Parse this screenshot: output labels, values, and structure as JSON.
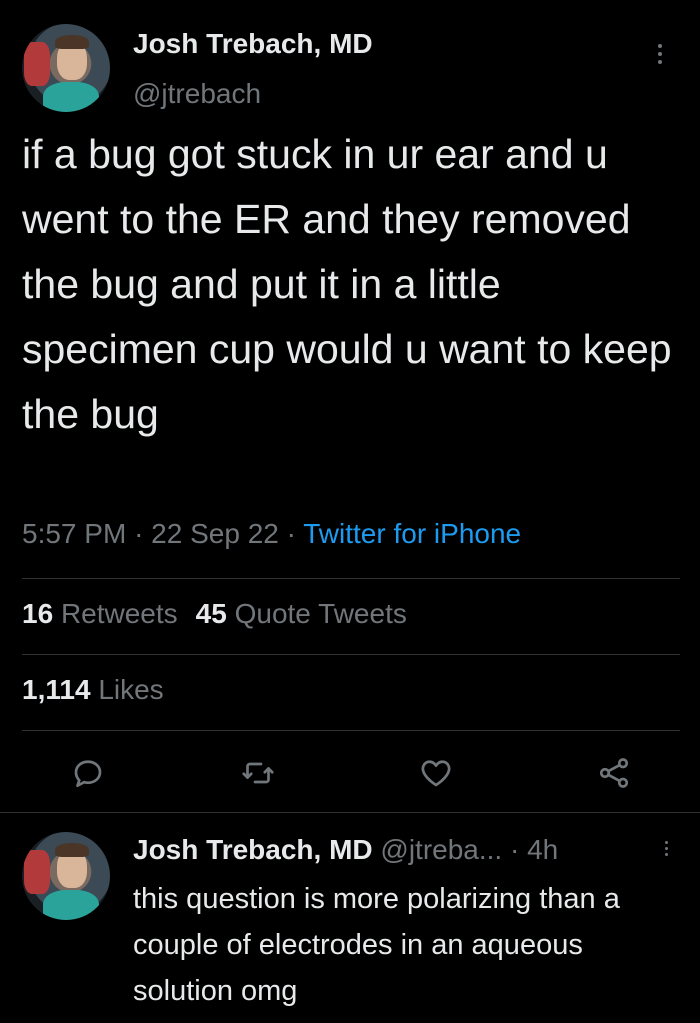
{
  "tweet": {
    "author_name": "Josh Trebach, MD",
    "author_handle": "@jtrebach",
    "text": "if a bug got stuck in ur ear and u went to the ER and they removed the bug and put it in a little specimen cup would u want to keep the bug",
    "time": "5:57 PM",
    "date": "22 Sep 22",
    "source": "Twitter for iPhone",
    "separator": "·",
    "retweets_count": "16",
    "retweets_label": "Retweets",
    "quotes_count": "45",
    "quotes_label": "Quote Tweets",
    "likes_count": "1,114",
    "likes_label": "Likes"
  },
  "actions": {
    "reply_icon": "reply-icon",
    "retweet_icon": "retweet-icon",
    "like_icon": "heart-icon",
    "share_icon": "share-icon"
  },
  "reply": {
    "author_name": "Josh Trebach, MD",
    "author_handle": "@jtreba...",
    "time_ago": "4h",
    "separator": "·",
    "text": "this question is more polarizing than a couple of electrodes in an aqueous solution omg"
  },
  "colors": {
    "background": "#000000",
    "text": "#e7e9ea",
    "secondary": "#71767b",
    "link": "#1d9bf0",
    "divider": "#2f3336"
  }
}
